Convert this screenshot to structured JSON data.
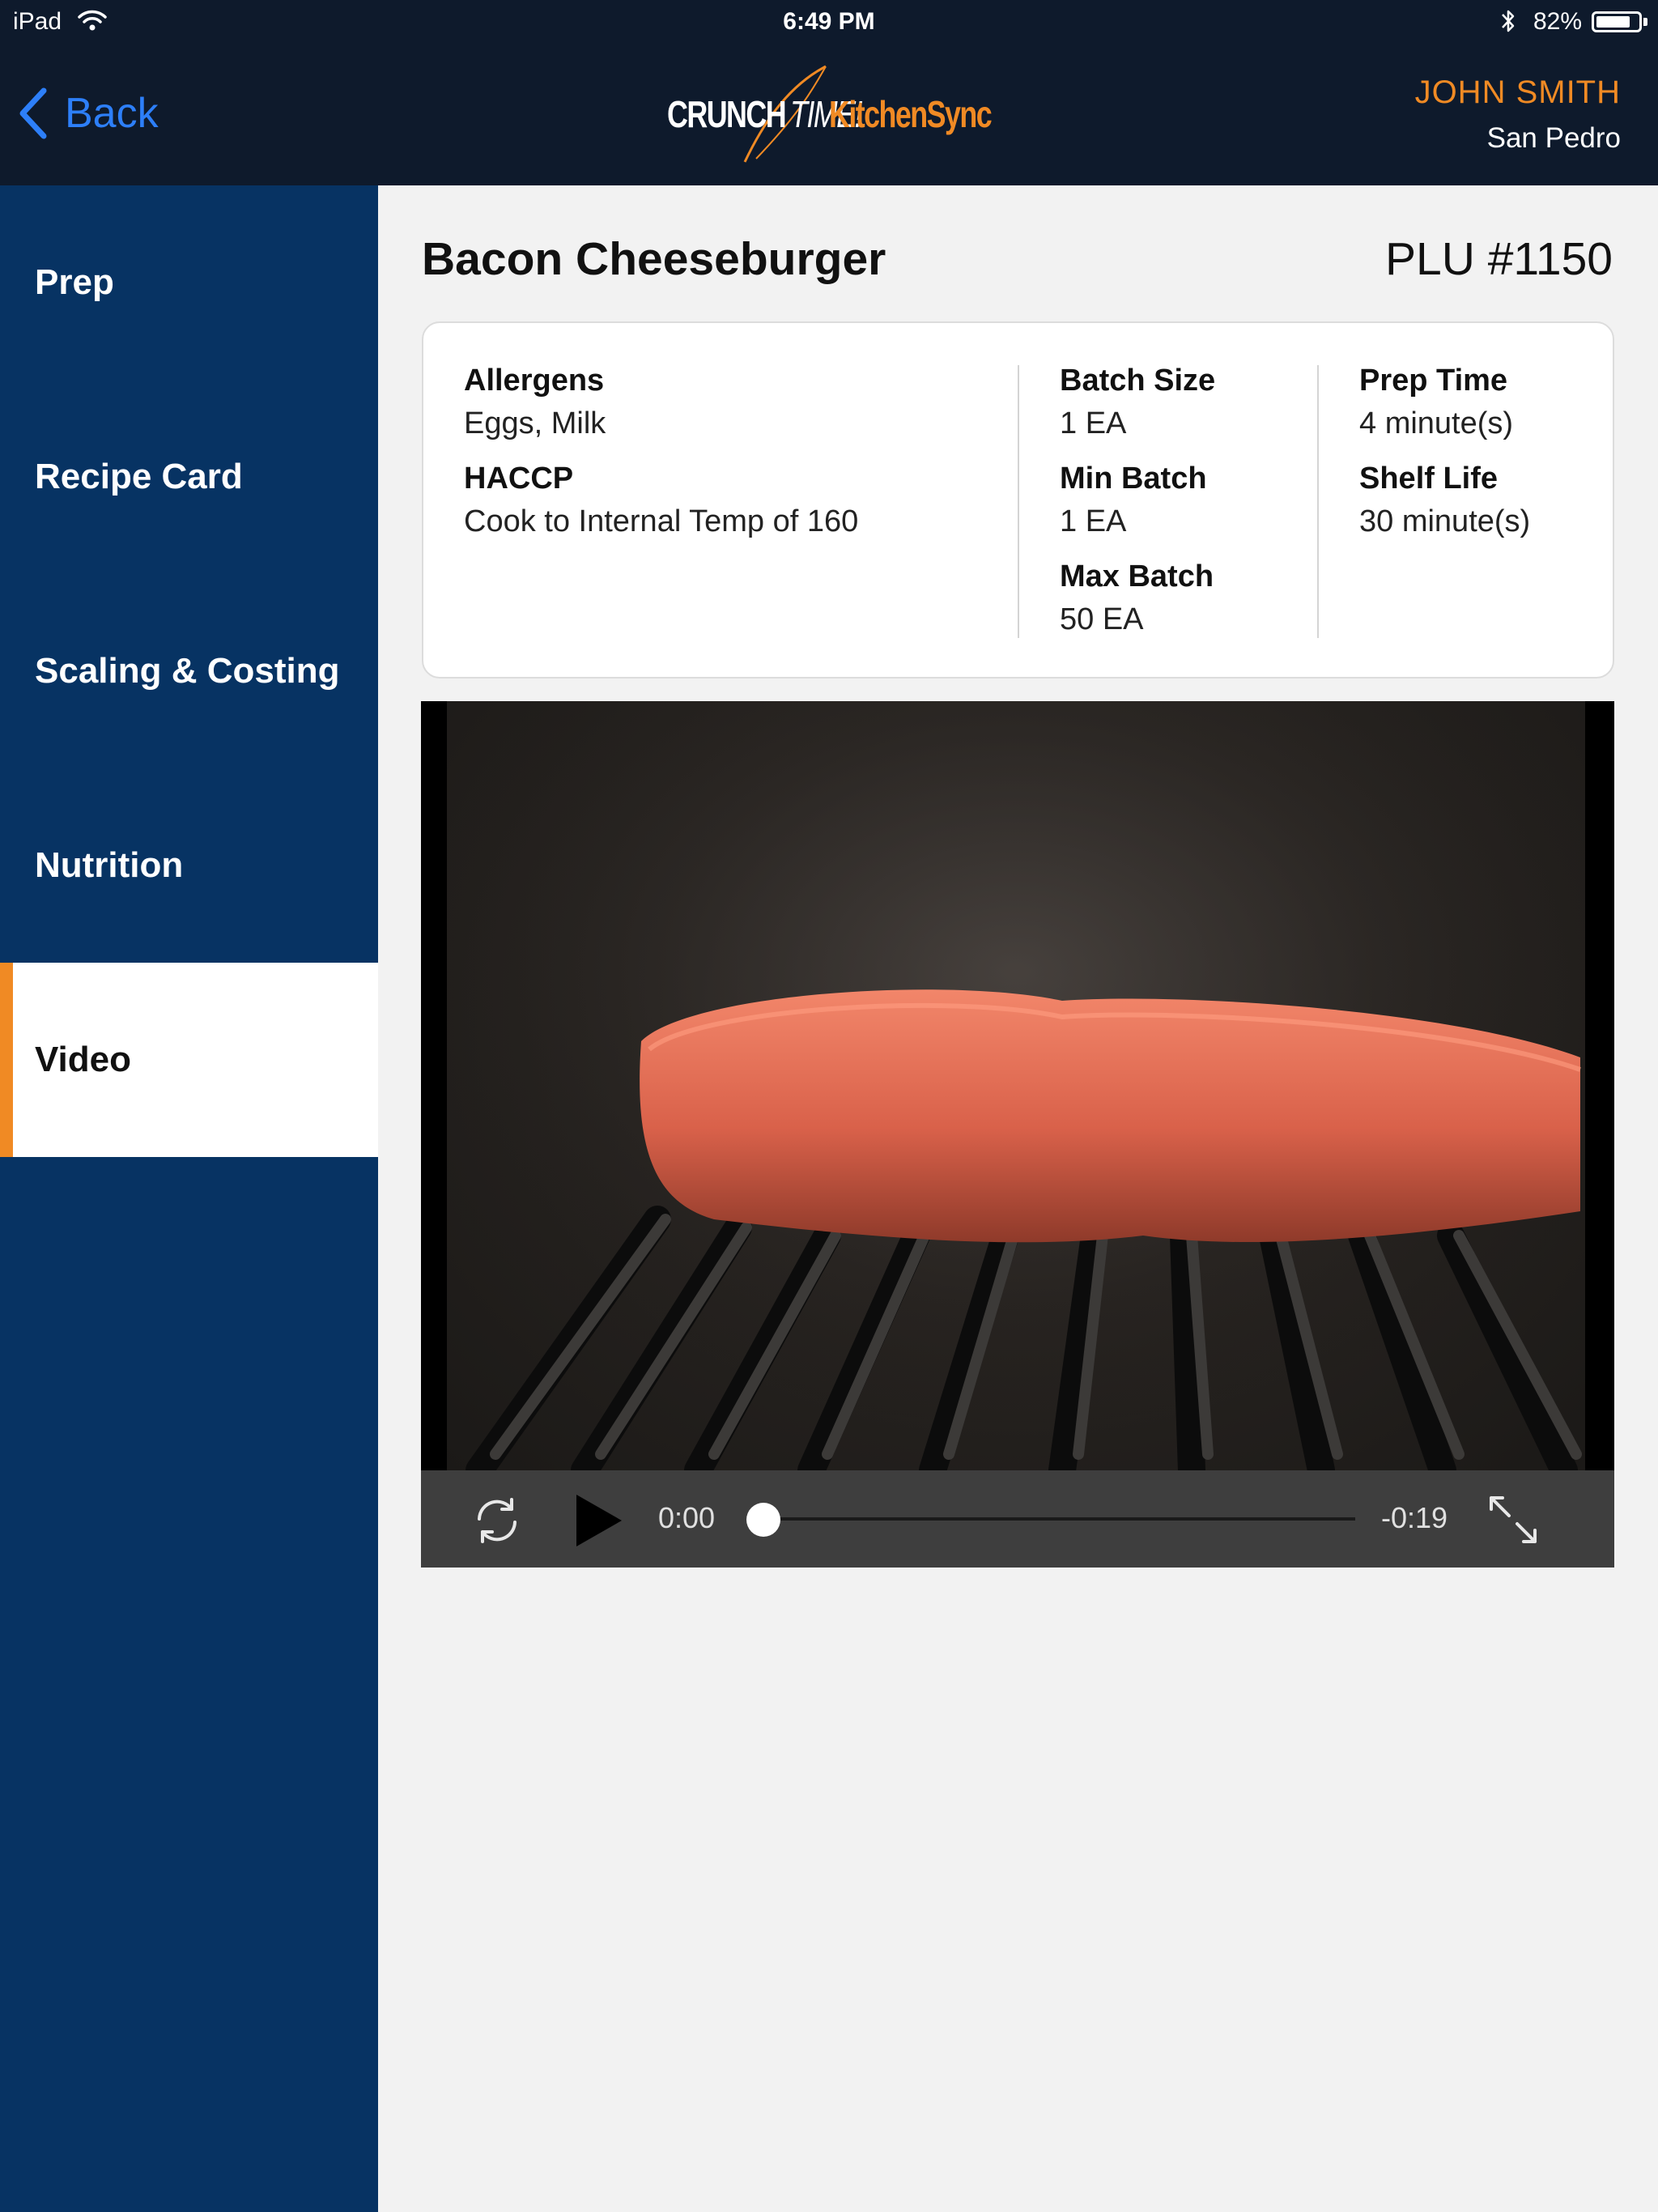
{
  "status_bar": {
    "carrier": "iPad",
    "time": "6:49 PM",
    "battery_percent": "82%",
    "battery_level": 0.82
  },
  "header": {
    "back_label": "Back",
    "logo": {
      "part1": "CRUNCH",
      "part2": "TIME!",
      "part3": "KitchenSync"
    },
    "user_name": "JOHN SMITH",
    "user_location": "San Pedro"
  },
  "sidebar": {
    "items": [
      {
        "label": "Prep",
        "active": false
      },
      {
        "label": "Recipe Card",
        "active": false
      },
      {
        "label": "Scaling & Costing",
        "active": false
      },
      {
        "label": "Nutrition",
        "active": false
      },
      {
        "label": "Video",
        "active": true
      }
    ]
  },
  "recipe": {
    "title": "Bacon Cheeseburger",
    "plu": "PLU #1150",
    "allergens_label": "Allergens",
    "allergens_value": "Eggs, Milk",
    "haccp_label": "HACCP",
    "haccp_value": "Cook to Internal Temp of 160",
    "batch_size_label": "Batch Size",
    "batch_size_value": "1 EA",
    "min_batch_label": "Min Batch",
    "min_batch_value": "1 EA",
    "max_batch_label": "Max Batch",
    "max_batch_value": "50 EA",
    "prep_time_label": "Prep Time",
    "prep_time_value": "4 minute(s)",
    "shelf_life_label": "Shelf Life",
    "shelf_life_value": "30 minute(s)"
  },
  "video": {
    "current_time": "0:00",
    "remaining_time": "-0:19",
    "progress": 0.0,
    "icons": [
      "repeat-icon",
      "play-icon",
      "fullscreen-icon"
    ]
  },
  "colors": {
    "header_bg": "#0e1a2c",
    "sidebar_bg": "#073363",
    "accent_orange": "#f08a24",
    "link_blue": "#2d7ff9"
  }
}
